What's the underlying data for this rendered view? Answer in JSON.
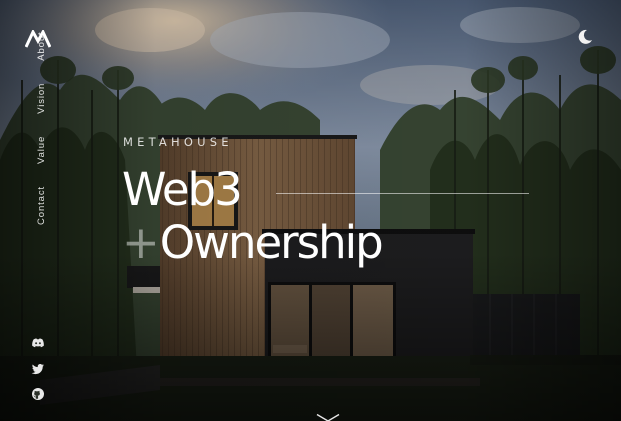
{
  "brand": {
    "logo_icon": "metahouse-monogram-icon"
  },
  "theme_toggle": {
    "icon": "moon-icon"
  },
  "nav": {
    "items": [
      "Contact",
      "Value",
      "Vision",
      "About"
    ]
  },
  "socials": [
    {
      "name": "discord",
      "icon": "discord-icon"
    },
    {
      "name": "twitter",
      "icon": "twitter-icon"
    },
    {
      "name": "github",
      "icon": "github-icon"
    }
  ],
  "hero": {
    "eyebrow": "METAHOUSE",
    "headline_line1": "Web3",
    "headline_plus": "+",
    "headline_line2": "Ownership"
  },
  "scroll_cue": {
    "icon": "chevron-down-icon"
  },
  "colors": {
    "text": "#ffffff",
    "accent_muted": "#9a9a9a",
    "sky": "#7d8ea4",
    "forest": "#26331f",
    "wood": "#7b5c3f",
    "dark_wall": "#1e1e1e"
  }
}
